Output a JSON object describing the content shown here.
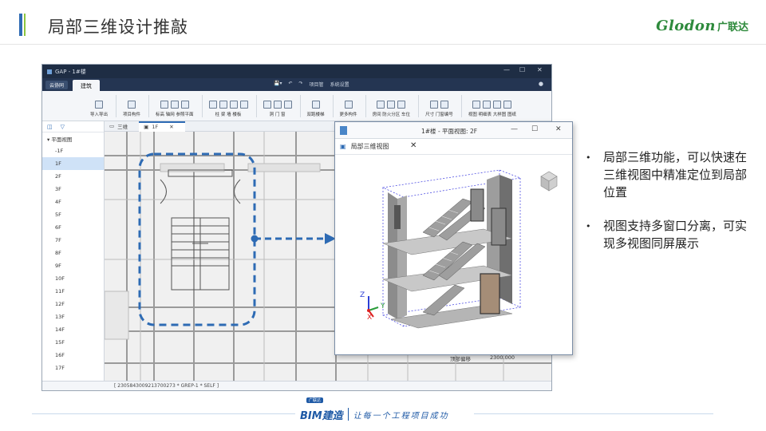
{
  "slide": {
    "title": "局部三维设计推敲",
    "logo_text": "Glodon",
    "logo_cn": "广联达"
  },
  "app": {
    "window_title": "GAP - 1#楼",
    "ribbon_tabs": [
      "云协同",
      "建筑"
    ],
    "toolbar_center": [
      "项目管",
      "系统设置"
    ],
    "ribbon_groups": [
      {
        "label": "导入导出"
      },
      {
        "label": "项目构件"
      },
      {
        "label": "标高 轴网 参照平面"
      },
      {
        "label": "柱  梁  墙  楼板"
      },
      {
        "label": "洞  门  窗"
      },
      {
        "label": "双跑楼梯"
      },
      {
        "label": "更多构件"
      },
      {
        "label": "房间 防火分区 车位"
      },
      {
        "label": "尺寸 门窗编号"
      },
      {
        "label": "视图 明细表 大样图 图纸"
      }
    ],
    "tree_root": "平面视图",
    "floors": [
      "-1F",
      "1F",
      "2F",
      "3F",
      "4F",
      "5F",
      "6F",
      "7F",
      "8F",
      "9F",
      "10F",
      "11F",
      "12F",
      "13F",
      "14F",
      "15F",
      "16F",
      "17F"
    ],
    "selected_floor": "1F",
    "doc_tabs": [
      "三维",
      "1F"
    ],
    "active_doc_tab": "1F",
    "status_text": "[ 2305843009213700273 * GREP-1 * SELF ]"
  },
  "float_window": {
    "title": "1#楼 - 平面视图: 2F",
    "tab": "局部三维视图",
    "axis_labels": {
      "z": "Z",
      "y": "Y",
      "x": "X"
    }
  },
  "props": {
    "label": "顶部偏移",
    "value": "2300.000"
  },
  "bullets": [
    "局部三维功能，可以快速在三维视图中精准定位到局部位置",
    "视图支持多窗口分离，可实现多视图同屏展示"
  ],
  "footer": {
    "badge": "广联达",
    "brand": "BIM建造",
    "slogan": "让每一个工程项目成功"
  },
  "colors": {
    "accent": "#2e6bb4",
    "green": "#8cc63f",
    "dashed": "#2e6bb4"
  }
}
